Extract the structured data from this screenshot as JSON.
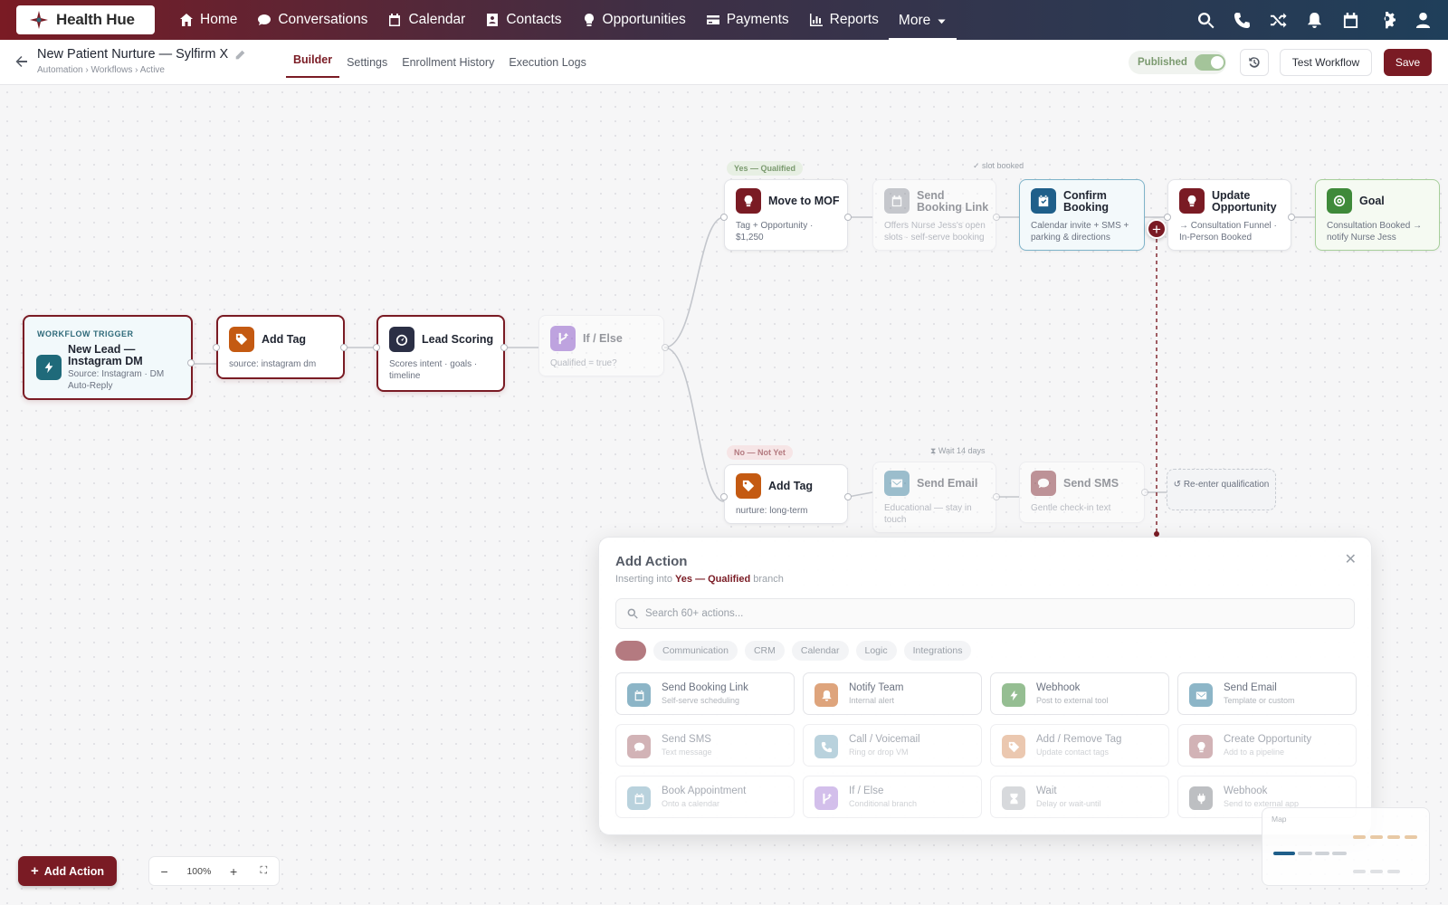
{
  "brand": {
    "name": "Health Hue",
    "primary": "#7a1b24"
  },
  "nav": {
    "items": [
      {
        "label": "Home",
        "icon": "home-icon"
      },
      {
        "label": "Conversations",
        "icon": "chat-icon"
      },
      {
        "label": "Calendar",
        "icon": "calendar-icon"
      },
      {
        "label": "Contacts",
        "icon": "contacts-icon"
      },
      {
        "label": "Opportunities",
        "icon": "lightbulb-icon"
      },
      {
        "label": "Payments",
        "icon": "card-icon"
      },
      {
        "label": "Reports",
        "icon": "chart-icon"
      },
      {
        "label": "More",
        "icon": "chevron-down-icon"
      }
    ],
    "right_icons": [
      "search-icon",
      "phone-icon",
      "shuffle-icon",
      "bell-icon",
      "calendar-icon",
      "gear-icon",
      "user-icon"
    ]
  },
  "header": {
    "title": "New Patient Nurture — Sylfirm X",
    "breadcrumb": "Automation › Workflows › Active",
    "tabs": [
      "Builder",
      "Settings",
      "Enrollment History",
      "Execution Logs"
    ],
    "active_tab": "Builder",
    "published_label": "Published",
    "published": true,
    "test_label": "Test Workflow",
    "save_label": "Save"
  },
  "nodes": {
    "trigger": {
      "label": "WORKFLOW TRIGGER",
      "title": "New Lead — Instagram DM",
      "desc": "Source: Instagram · DM Auto-Reply"
    },
    "add_tag_1": {
      "title": "Add Tag",
      "desc": "source: instagram dm"
    },
    "lead_scoring": {
      "title": "Lead Scoring",
      "desc": "Scores intent · goals · timeline"
    },
    "if_else": {
      "title": "If / Else",
      "desc": "Qualified = true?"
    },
    "yes_branch": "Yes — Qualified",
    "no_branch": "No — Not Yet",
    "slot_note": "slot booked",
    "wait_note": "Wait 14 days",
    "move_mof": {
      "title": "Move to MOF",
      "desc": "Tag + Opportunity · $1,250"
    },
    "send_booking": {
      "title": "Send Booking Link",
      "desc": "Offers Nurse Jess's open slots · self-serve booking"
    },
    "confirm_booking": {
      "title": "Confirm Booking",
      "desc": "Calendar invite + SMS + parking & directions"
    },
    "update_opp": {
      "title": "Update Opportunity",
      "desc": "→ Consultation Funnel · In-Person Booked"
    },
    "goal": {
      "title": "Goal",
      "desc": "Consultation Booked → notify Nurse Jess"
    },
    "add_tag_2": {
      "title": "Add Tag",
      "desc": "nurture: long-term"
    },
    "send_email": {
      "title": "Send Email",
      "desc": "Educational — stay in touch"
    },
    "send_sms": {
      "title": "Send SMS",
      "desc": "Gentle check-in text"
    },
    "reenter": "↺ Re-enter qualification"
  },
  "panel": {
    "title": "Add Action",
    "sub_prefix": "Inserting into",
    "sub_branch": "Yes — Qualified",
    "sub_suffix": "branch",
    "search_placeholder": "Search 60+ actions...",
    "categories": [
      "",
      "Communication",
      "CRM",
      "Calendar",
      "Logic",
      "Integrations"
    ],
    "actions": [
      {
        "title": "Send Booking Link",
        "desc": "Self-serve scheduling",
        "color": "#2f7a9a",
        "icon": "calendar-icon"
      },
      {
        "title": "Notify Team",
        "desc": "Internal alert",
        "color": "#c45a12",
        "icon": "bell-icon"
      },
      {
        "title": "Webhook",
        "desc": "Post to external tool",
        "color": "#3f8a3a",
        "icon": "bolt-icon"
      },
      {
        "title": "Send Email",
        "desc": "Template or custom",
        "color": "#2f7a9a",
        "icon": "mail-icon"
      },
      {
        "title": "Send SMS",
        "desc": "Text message",
        "color": "#7a1b24",
        "icon": "chat-icon"
      },
      {
        "title": "Call / Voicemail",
        "desc": "Ring or drop VM",
        "color": "#2f7a9a",
        "icon": "phone-icon"
      },
      {
        "title": "Add / Remove Tag",
        "desc": "Update contact tags",
        "color": "#c45a12",
        "icon": "tag-icon"
      },
      {
        "title": "Create Opportunity",
        "desc": "Add to a pipeline",
        "color": "#7a1b24",
        "icon": "lightbulb-icon"
      },
      {
        "title": "Book Appointment",
        "desc": "Onto a calendar",
        "color": "#2f7a9a",
        "icon": "calendar-icon"
      },
      {
        "title": "If / Else",
        "desc": "Conditional branch",
        "color": "#7b3fc4",
        "icon": "branch-icon"
      },
      {
        "title": "Wait",
        "desc": "Delay or wait-until",
        "color": "#8a8f99",
        "icon": "hourglass-icon"
      },
      {
        "title": "Webhook",
        "desc": "Send to external app",
        "color": "#3a3f48",
        "icon": "plug-icon"
      }
    ]
  },
  "controls": {
    "add_action_label": "Add Action",
    "zoom": "100%",
    "minimap_label": "Map"
  }
}
